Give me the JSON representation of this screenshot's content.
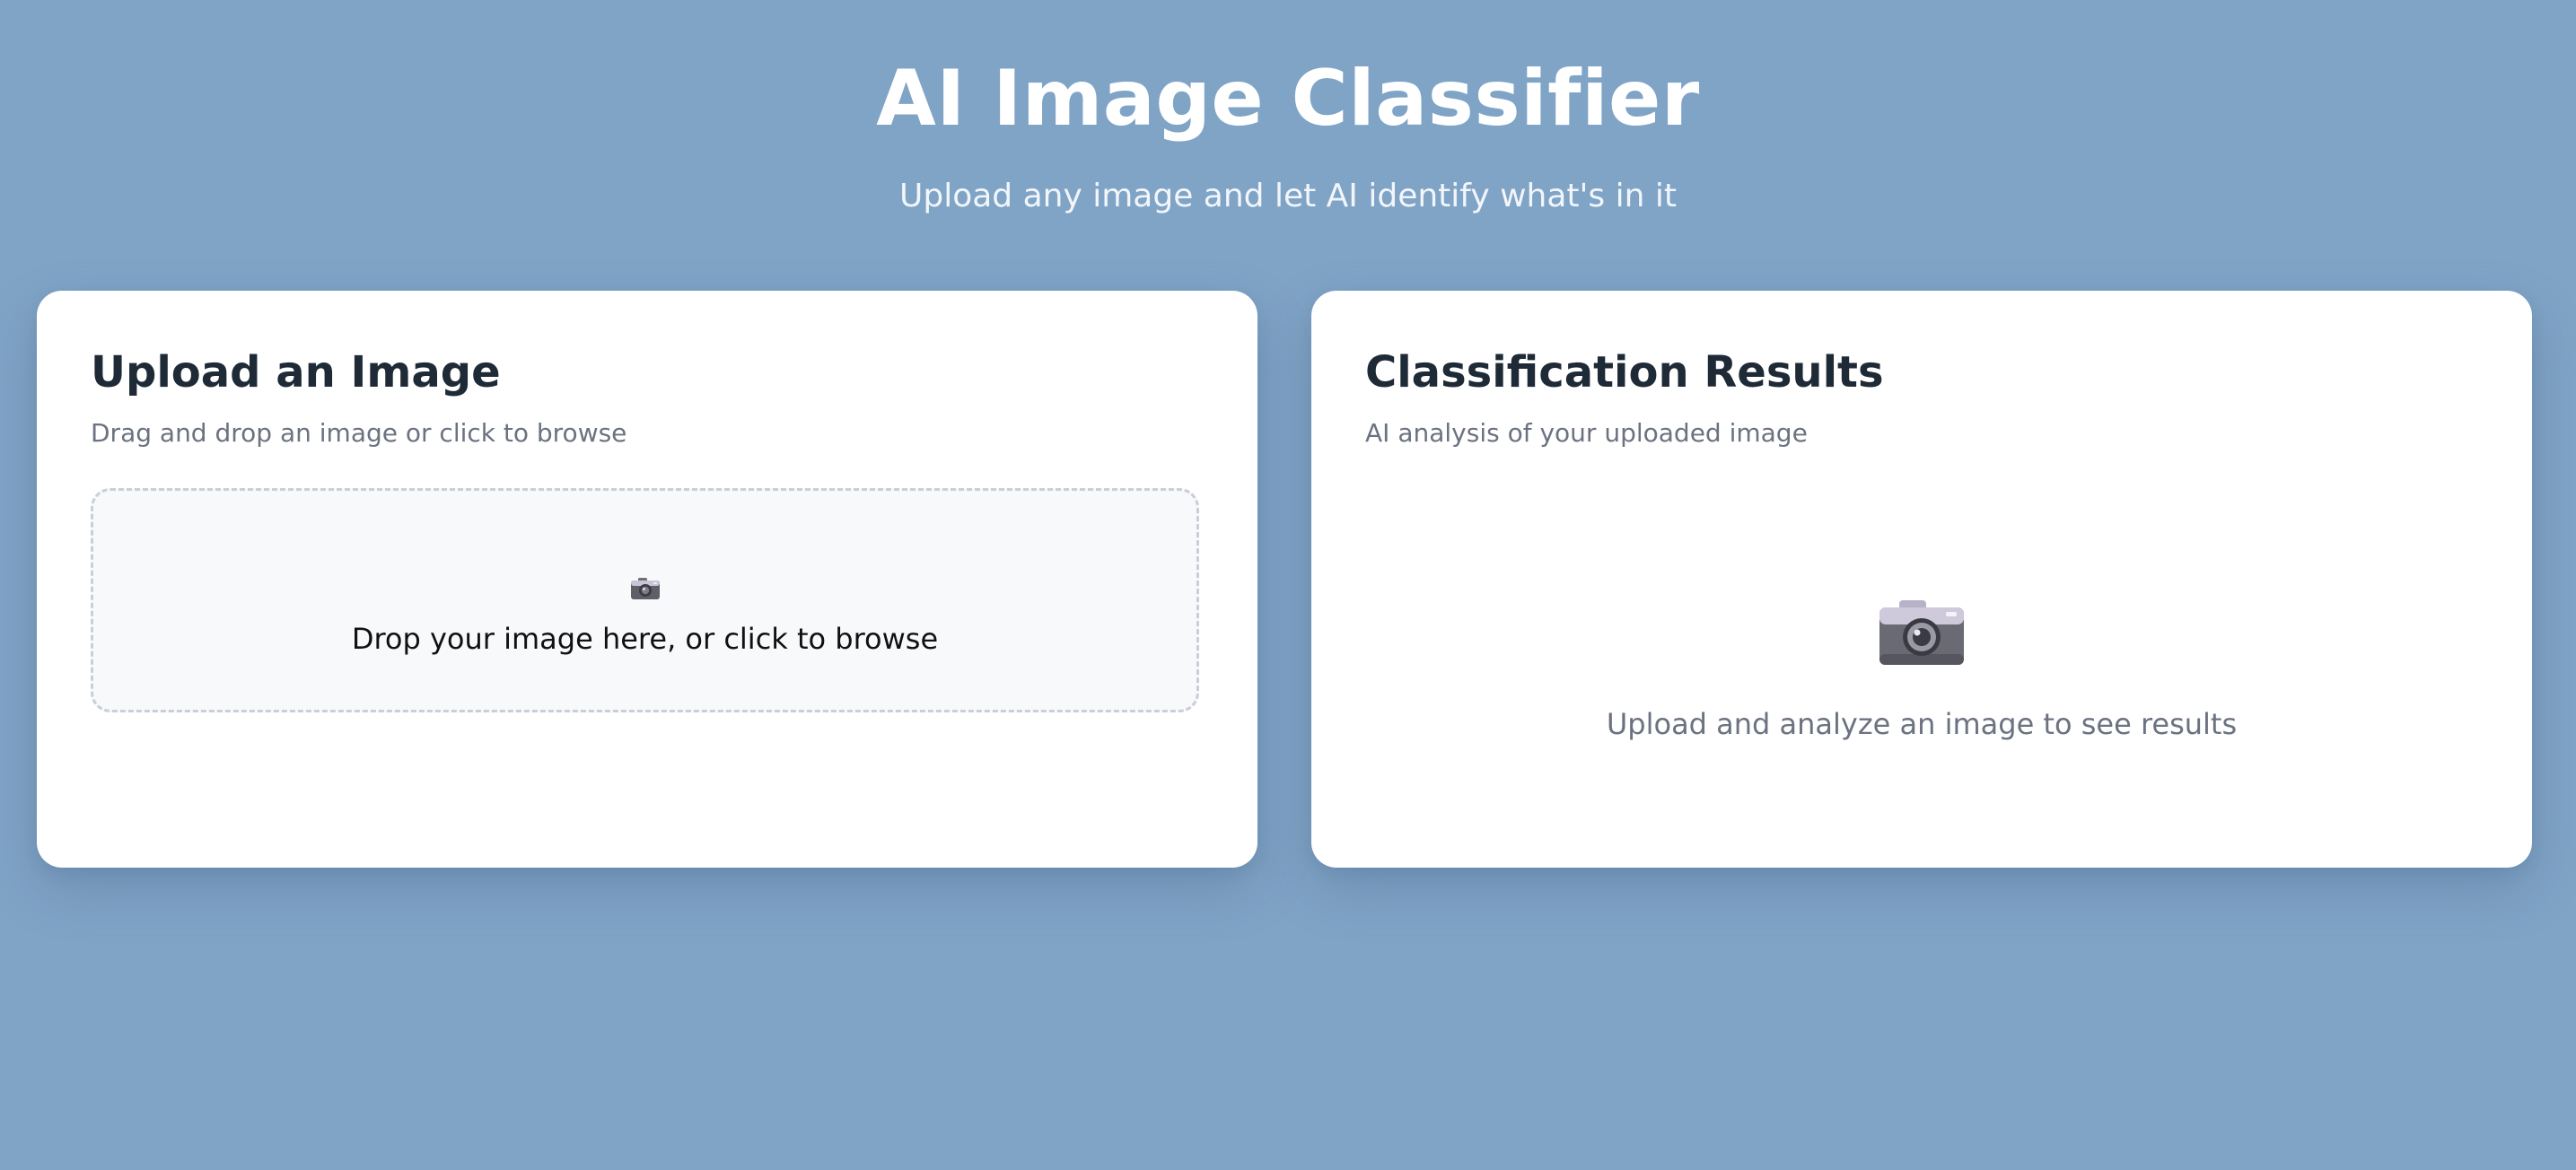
{
  "app": {
    "title": "AI Image Classifier",
    "subtitle": "Upload any image and let AI identify what's in it"
  },
  "upload": {
    "title": "Upload an Image",
    "subtitle": "Drag and drop an image or click to browse",
    "dropzone_icon": "camera-icon",
    "dropzone_text": "Drop your image here, or click to browse"
  },
  "results": {
    "title": "Classification Results",
    "subtitle": "AI analysis of your uploaded image",
    "empty_icon": "camera-icon",
    "empty_text": "Upload and analyze an image to see results"
  },
  "colors": {
    "background": "#80a4c6",
    "card": "#ffffff",
    "title_text": "#1f2a37",
    "muted_text": "#6b7280",
    "dropzone_border": "#c9ced8",
    "dropzone_bg": "#f7f9fb"
  }
}
